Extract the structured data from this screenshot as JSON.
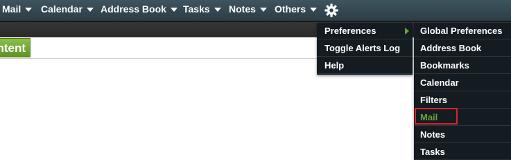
{
  "nav": {
    "items": [
      {
        "label": "Mail"
      },
      {
        "label": "Calendar"
      },
      {
        "label": "Address Book"
      },
      {
        "label": "Tasks"
      },
      {
        "label": "Notes"
      },
      {
        "label": "Others"
      }
    ],
    "settings_icon": "gear-icon"
  },
  "content": {
    "button_label": "ntent"
  },
  "menus": {
    "main": {
      "items": [
        {
          "label": "Preferences",
          "has_submenu": true
        },
        {
          "label": "Toggle Alerts Log"
        },
        {
          "label": "Help"
        }
      ]
    },
    "preferences": {
      "items": [
        {
          "label": "Global Preferences"
        },
        {
          "label": "Address Book"
        },
        {
          "label": "Bookmarks"
        },
        {
          "label": "Calendar"
        },
        {
          "label": "Filters"
        },
        {
          "label": "Mail",
          "active": true
        },
        {
          "label": "Notes"
        },
        {
          "label": "Tasks"
        }
      ]
    }
  },
  "colors": {
    "topbar": "#34474f",
    "menu_bg": "#141c22",
    "accent_green": "#6aa33a",
    "highlight_red": "#d9232e"
  }
}
